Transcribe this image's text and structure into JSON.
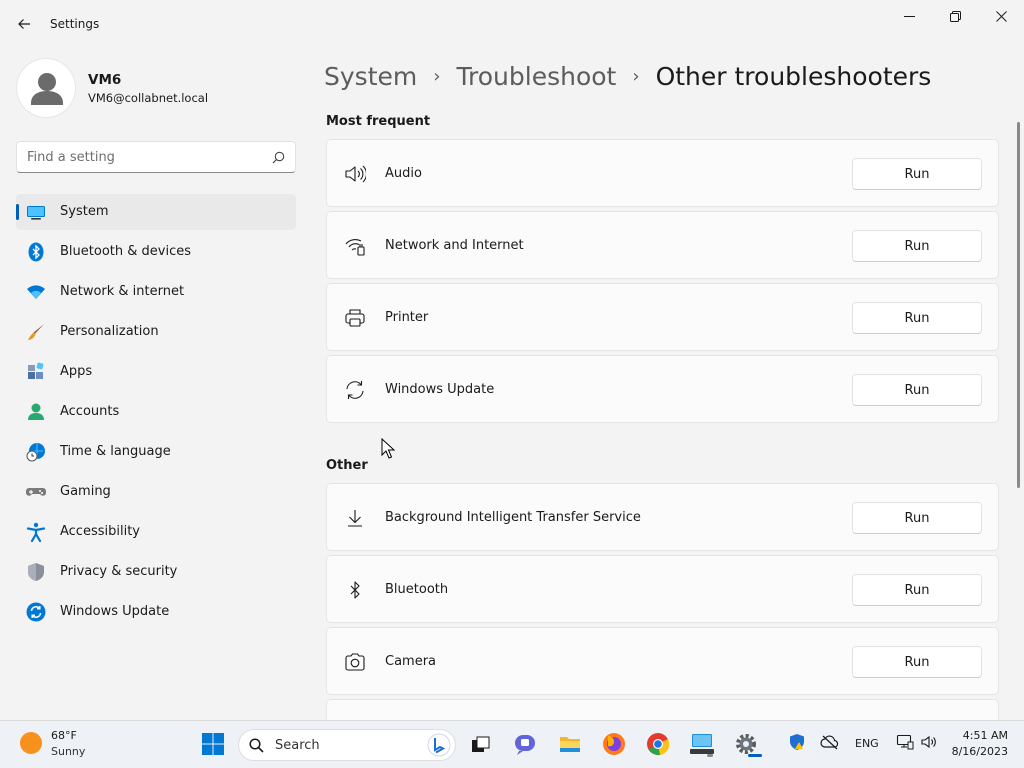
{
  "window": {
    "title": "Settings",
    "controls": {
      "minimize": "minimize-icon",
      "maximize": "restore-icon",
      "close": "close-icon"
    }
  },
  "profile": {
    "name": "VM6",
    "email": "VM6@collabnet.local"
  },
  "search": {
    "placeholder": "Find a setting"
  },
  "sidebar": {
    "items": [
      {
        "label": "System",
        "icon": "system-icon",
        "active": true
      },
      {
        "label": "Bluetooth & devices",
        "icon": "bluetooth-icon"
      },
      {
        "label": "Network & internet",
        "icon": "wifi-icon"
      },
      {
        "label": "Personalization",
        "icon": "brush-icon"
      },
      {
        "label": "Apps",
        "icon": "apps-icon"
      },
      {
        "label": "Accounts",
        "icon": "person-icon"
      },
      {
        "label": "Time & language",
        "icon": "globe-clock-icon"
      },
      {
        "label": "Gaming",
        "icon": "gamepad-icon"
      },
      {
        "label": "Accessibility",
        "icon": "accessibility-icon"
      },
      {
        "label": "Privacy & security",
        "icon": "shield-icon"
      },
      {
        "label": "Windows Update",
        "icon": "update-icon"
      }
    ]
  },
  "breadcrumb": {
    "parts": [
      "System",
      "Troubleshoot",
      "Other troubleshooters"
    ],
    "separator": "›"
  },
  "sections": {
    "most_frequent": {
      "title": "Most frequent",
      "items": [
        {
          "label": "Audio",
          "icon": "speaker-icon",
          "action": "Run"
        },
        {
          "label": "Network and Internet",
          "icon": "network-icon",
          "action": "Run"
        },
        {
          "label": "Printer",
          "icon": "printer-icon",
          "action": "Run"
        },
        {
          "label": "Windows Update",
          "icon": "sync-icon",
          "action": "Run"
        }
      ]
    },
    "other": {
      "title": "Other",
      "items": [
        {
          "label": "Background Intelligent Transfer Service",
          "icon": "download-icon",
          "action": "Run"
        },
        {
          "label": "Bluetooth",
          "icon": "bluetooth-icon",
          "action": "Run"
        },
        {
          "label": "Camera",
          "icon": "camera-icon",
          "action": "Run"
        }
      ]
    }
  },
  "taskbar": {
    "weather": {
      "temp": "68°F",
      "condition": "Sunny"
    },
    "search_label": "Search",
    "language": "ENG",
    "time": "4:51 AM",
    "date": "8/16/2023"
  },
  "colors": {
    "accent": "#005fb8",
    "background": "#f3f3f3",
    "card": "#fbfbfb"
  }
}
